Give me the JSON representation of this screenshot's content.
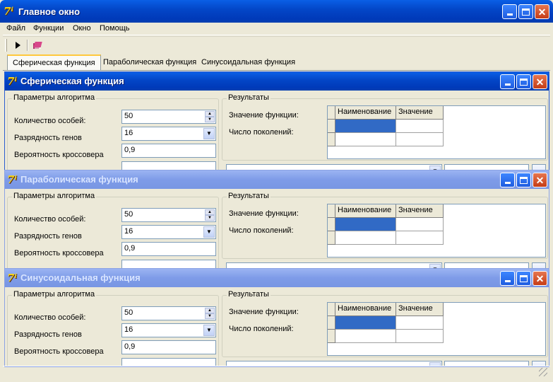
{
  "window": {
    "title": "Главное окно"
  },
  "menu": [
    "Файл",
    "Функции",
    "Окно",
    "Помощь"
  ],
  "toolbar": {
    "run_icon": "play-icon",
    "book_icon": "book-icon"
  },
  "tabs": [
    {
      "label": "Сферическая функция",
      "active": true
    },
    {
      "label": "Параболическая функция",
      "active": false
    },
    {
      "label": "Синусоидальная функция",
      "active": false
    }
  ],
  "children": [
    {
      "title": "Сферическая функция",
      "active": true,
      "params": {
        "group": "Параметры алгоритма",
        "count_label": "Количество особей:",
        "count_value": "50",
        "bits_label": "Разрядность генов",
        "bits_value": "16",
        "cross_label": "Вероятность кроссовера",
        "cross_value": "0,9"
      },
      "results": {
        "group": "Результаты",
        "func_label": "Значение функции:",
        "gen_label": "Число поколений:",
        "col_name": "Наименование",
        "col_value": "Значение"
      }
    },
    {
      "title": "Параболическая функция",
      "active": false,
      "params": {
        "group": "Параметры алгоритма",
        "count_label": "Количество особей:",
        "count_value": "50",
        "bits_label": "Разрядность генов",
        "bits_value": "16",
        "cross_label": "Вероятность кроссовера",
        "cross_value": "0,9"
      },
      "results": {
        "group": "Результаты",
        "func_label": "Значение функции:",
        "gen_label": "Число поколений:",
        "col_name": "Наименование",
        "col_value": "Значение"
      }
    },
    {
      "title": "Синусоидальная функция",
      "active": false,
      "params": {
        "group": "Параметры алгоритма",
        "count_label": "Количество особей:",
        "count_value": "50",
        "bits_label": "Разрядность генов",
        "bits_value": "16",
        "cross_label": "Вероятность кроссовера",
        "cross_value": "0,9"
      },
      "results": {
        "group": "Результаты",
        "func_label": "Значение функции:",
        "gen_label": "Число поколений:",
        "col_name": "Наименование",
        "col_value": "Значение"
      }
    }
  ],
  "colors": {
    "titlebar": "#0347C8",
    "selection": "#316AC5",
    "face": "#ECE9D8"
  }
}
